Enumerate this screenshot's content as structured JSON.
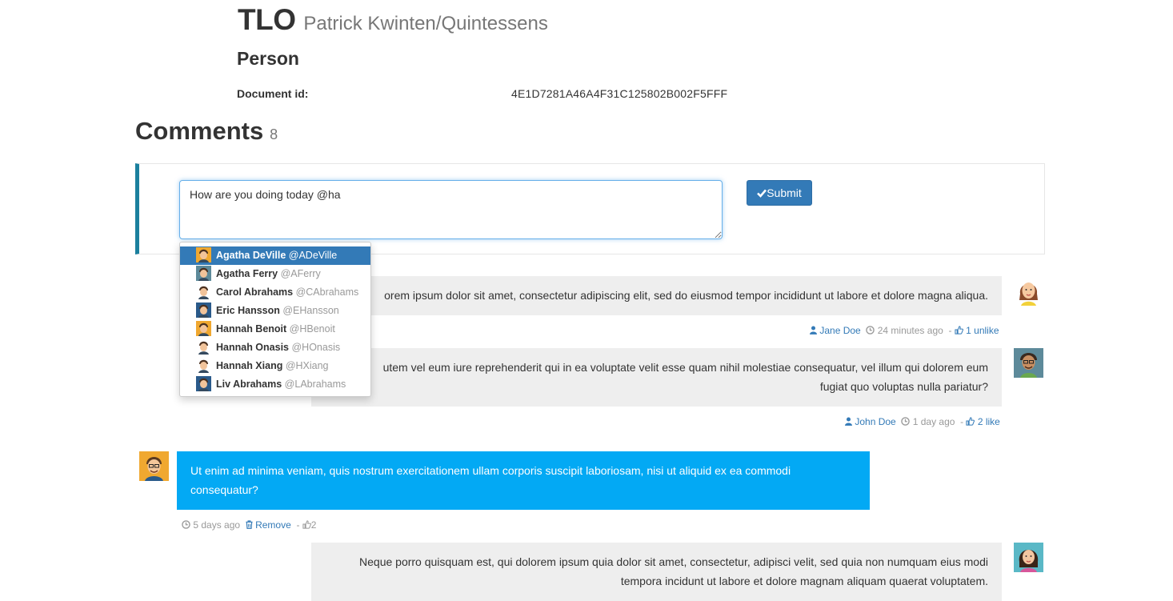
{
  "header": {
    "title": "TLO",
    "subtitle": "Patrick Kwinten/Quintessens",
    "section_heading": "Person",
    "doc_label": "Document id:",
    "doc_value": "4E1D7281A46A4F31C125802B002F5FFF"
  },
  "comments": {
    "heading": "Comments",
    "count": "8"
  },
  "editor": {
    "value": "How are you doing today @ha",
    "submit_label": "Submit"
  },
  "mentions": [
    {
      "name": "Agatha DeVille",
      "handle": "@ADeVille",
      "active": true
    },
    {
      "name": "Agatha Ferry",
      "handle": "@AFerry"
    },
    {
      "name": "Carol Abrahams",
      "handle": "@CAbrahams"
    },
    {
      "name": "Eric Hansson",
      "handle": "@EHansson"
    },
    {
      "name": "Hannah Benoit",
      "handle": "@HBenoit"
    },
    {
      "name": "Hannah Onasis",
      "handle": "@HOnasis"
    },
    {
      "name": "Hannah Xiang",
      "handle": "@HXiang"
    },
    {
      "name": "Liv Abrahams",
      "handle": "@LAbrahams"
    }
  ],
  "thread": [
    {
      "text": "Lorem ipsum dolor sit amet, consectetur adipiscing elit, sed do eiusmod tempor incididunt ut labore et dolore magna aliqua.",
      "visible_text": "orem ipsum dolor sit amet, consectetur adipiscing elit, sed do eiusmod tempor incididunt ut labore et dolore magna aliqua.",
      "author": "Jane Doe",
      "time": "24 minutes ago",
      "sep": "-",
      "action": "1 unlike"
    },
    {
      "visible_line1": "utem vel eum iure reprehenderit qui in ea voluptate velit esse quam nihil molestiae consequatur, vel illum qui dolorem eum",
      "visible_line2": "fugiat quo voluptas nulla pariatur?",
      "author": "John Doe",
      "time": "1 day ago",
      "sep": "-",
      "action": "2 like"
    },
    {
      "line1": "Ut enim ad minima veniam, quis nostrum exercitationem ullam corporis suscipit laboriosam, nisi ut aliquid ex ea commodi",
      "line2": "consequatur?",
      "time": "5 days ago",
      "remove_label": "Remove",
      "sep": "-",
      "likes": "2"
    },
    {
      "line1": "Neque porro quisquam est, qui dolorem ipsum quia dolor sit amet, consectetur, adipisci velit, sed quia non numquam eius modi",
      "line2": "tempora incidunt ut labore et dolore magnam aliquam quaerat voluptatem."
    }
  ],
  "icons": [
    "check-icon",
    "user-icon",
    "clock-icon",
    "thumbs-up-icon",
    "trash-icon"
  ],
  "colors": {
    "accent": "#337ab7",
    "box_border": "#1b809e",
    "own_bubble": "#03a9f4",
    "other_bubble": "#eeeeee"
  }
}
